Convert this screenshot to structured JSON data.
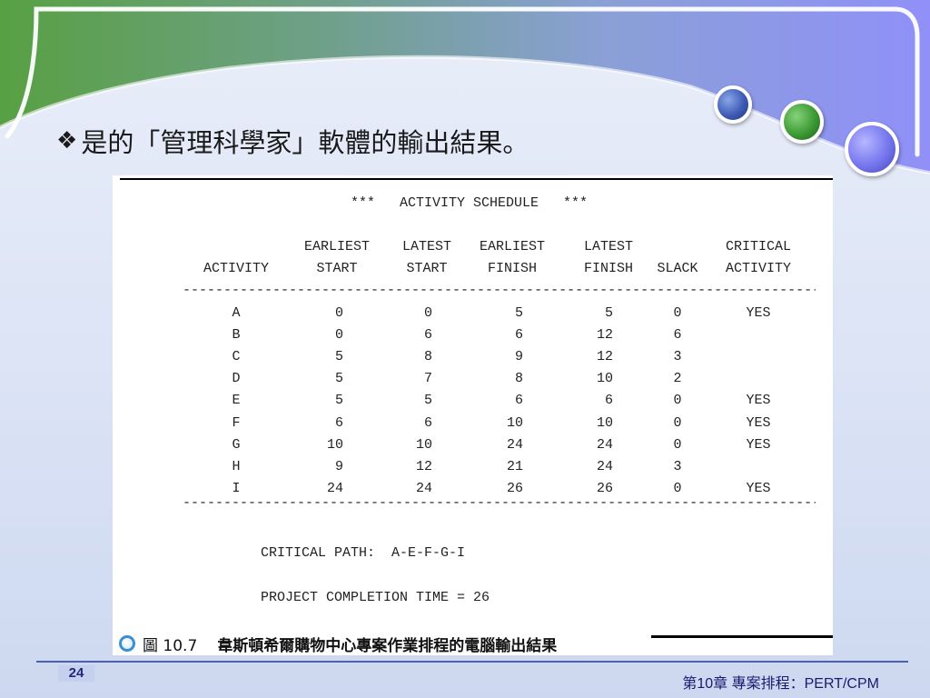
{
  "slide": {
    "title": "是的「管理科學家」軟體的輸出結果。",
    "bullet_icon": "diamond-bullet",
    "page_number": "24",
    "footer": "第10章 專案排程：PERT/CPM"
  },
  "schedule": {
    "title": "***   ACTIVITY SCHEDULE   ***",
    "headers_row1": [
      "",
      "EARLIEST",
      "LATEST",
      "EARLIEST",
      "LATEST",
      "",
      "CRITICAL"
    ],
    "headers_row2": [
      "ACTIVITY",
      "START",
      "START",
      "FINISH",
      "FINISH",
      "SLACK",
      "ACTIVITY"
    ],
    "rows": [
      [
        "A",
        "0",
        "0",
        "5",
        "5",
        "0",
        "YES"
      ],
      [
        "B",
        "0",
        "6",
        "6",
        "12",
        "6",
        ""
      ],
      [
        "C",
        "5",
        "8",
        "9",
        "12",
        "3",
        ""
      ],
      [
        "D",
        "5",
        "7",
        "8",
        "10",
        "2",
        ""
      ],
      [
        "E",
        "5",
        "5",
        "6",
        "6",
        "0",
        "YES"
      ],
      [
        "F",
        "6",
        "6",
        "10",
        "10",
        "0",
        "YES"
      ],
      [
        "G",
        "10",
        "10",
        "24",
        "24",
        "0",
        "YES"
      ],
      [
        "H",
        "9",
        "12",
        "21",
        "24",
        "3",
        ""
      ],
      [
        "I",
        "24",
        "24",
        "26",
        "26",
        "0",
        "YES"
      ]
    ],
    "critical_path": "CRITICAL PATH:  A-E-F-G-I",
    "completion_time": "PROJECT COMPLETION TIME = 26"
  },
  "caption": {
    "label": "圖 10.7",
    "text": "韋斯頓希爾購物中心專案作業排程的電腦輸出結果"
  },
  "colors": {
    "banner_green": "#5a9e4a",
    "banner_purple": "#8f8ff7",
    "rule_blue": "#4a5fb8"
  }
}
